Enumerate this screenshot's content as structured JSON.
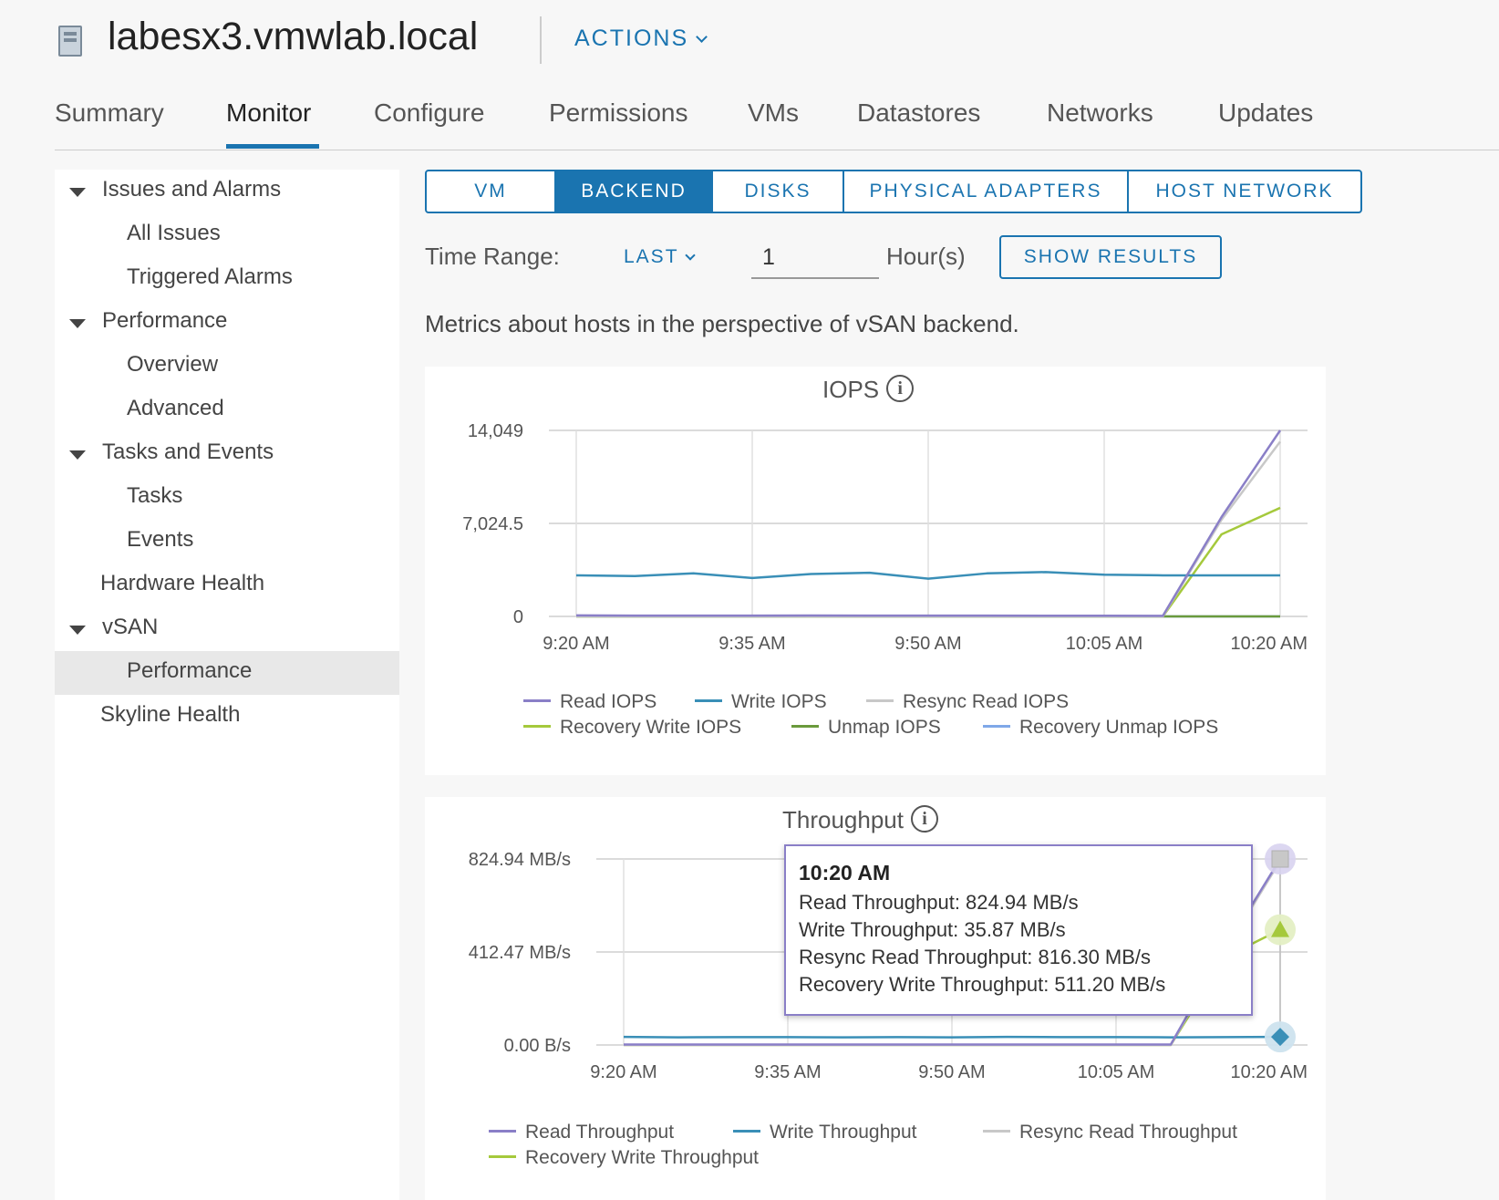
{
  "header": {
    "host_name": "labesx3.vmwlab.local",
    "actions_label": "ACTIONS"
  },
  "tabs": [
    "Summary",
    "Monitor",
    "Configure",
    "Permissions",
    "VMs",
    "Datastores",
    "Networks",
    "Updates"
  ],
  "active_tab": "Monitor",
  "sidebar": {
    "issues_and_alarms": "Issues and Alarms",
    "all_issues": "All Issues",
    "triggered_alarms": "Triggered Alarms",
    "performance": "Performance",
    "overview": "Overview",
    "advanced": "Advanced",
    "tasks_and_events": "Tasks and Events",
    "tasks": "Tasks",
    "events": "Events",
    "hardware_health": "Hardware Health",
    "vsan": "vSAN",
    "vsan_performance": "Performance",
    "skyline_health": "Skyline Health",
    "selected": "vsan_performance"
  },
  "subtabs": [
    "VM",
    "BACKEND",
    "DISKS",
    "PHYSICAL ADAPTERS",
    "HOST NETWORK"
  ],
  "active_subtab": "BACKEND",
  "time_range": {
    "label": "Time Range:",
    "mode": "LAST",
    "value": "1",
    "unit_label": "Hour(s)",
    "show_results_label": "SHOW RESULTS"
  },
  "description": "Metrics about hosts in the perspective of vSAN backend.",
  "colors": {
    "accent": "#1a74b0",
    "read": "#8a7fc7",
    "write": "#3a8fb7",
    "resync_read": "#c8c8c8",
    "recovery_write": "#a5c93c",
    "unmap": "#6a9a3c",
    "recovery_unmap": "#7fa8e8"
  },
  "chart_data": [
    {
      "type": "line",
      "title": "IOPS",
      "x": [
        "9:20 AM",
        "9:25 AM",
        "9:30 AM",
        "9:35 AM",
        "9:40 AM",
        "9:45 AM",
        "9:50 AM",
        "9:55 AM",
        "10:00 AM",
        "10:05 AM",
        "10:10 AM",
        "10:15 AM",
        "10:20 AM"
      ],
      "x_ticks": [
        "9:20 AM",
        "9:35 AM",
        "9:50 AM",
        "10:05 AM",
        "10:20 AM"
      ],
      "y_ticks": [
        "14,049",
        "7,024.5",
        "0"
      ],
      "ylim": [
        0,
        14049
      ],
      "series": [
        {
          "name": "Read IOPS",
          "color": "#8a7fc7",
          "values": [
            80,
            60,
            60,
            60,
            70,
            60,
            60,
            60,
            50,
            50,
            40,
            7500,
            14049
          ]
        },
        {
          "name": "Write IOPS",
          "color": "#3a8fb7",
          "values": [
            3100,
            3050,
            3250,
            2900,
            3200,
            3300,
            2850,
            3250,
            3350,
            3150,
            3100,
            3100,
            3100
          ]
        },
        {
          "name": "Resync Read IOPS",
          "color": "#c8c8c8",
          "values": [
            0,
            0,
            0,
            0,
            0,
            0,
            0,
            0,
            0,
            0,
            0,
            7300,
            13200
          ]
        },
        {
          "name": "Recovery Write IOPS",
          "color": "#a5c93c",
          "values": [
            0,
            0,
            0,
            0,
            0,
            0,
            0,
            0,
            0,
            0,
            0,
            6200,
            8200
          ]
        },
        {
          "name": "Unmap IOPS",
          "color": "#6a9a3c",
          "values": [
            0,
            0,
            0,
            0,
            0,
            0,
            0,
            0,
            0,
            0,
            0,
            0,
            0
          ]
        },
        {
          "name": "Recovery Unmap IOPS",
          "color": "#7fa8e8",
          "values": [
            0,
            0,
            0,
            0,
            0,
            0,
            0,
            0,
            0,
            0,
            0,
            0,
            0
          ]
        }
      ]
    },
    {
      "type": "line",
      "title": "Throughput",
      "x": [
        "9:20 AM",
        "9:25 AM",
        "9:30 AM",
        "9:35 AM",
        "9:40 AM",
        "9:45 AM",
        "9:50 AM",
        "9:55 AM",
        "10:00 AM",
        "10:05 AM",
        "10:10 AM",
        "10:15 AM",
        "10:20 AM"
      ],
      "x_ticks": [
        "9:20 AM",
        "9:35 AM",
        "9:50 AM",
        "10:05 AM",
        "10:20 AM"
      ],
      "y_ticks": [
        "824.94 MB/s",
        "412.47 MB/s",
        "0.00 B/s"
      ],
      "ylim": [
        0,
        824.94
      ],
      "series": [
        {
          "name": "Read Throughput",
          "color": "#8a7fc7",
          "values": [
            2,
            2,
            2,
            2,
            2,
            2,
            2,
            2,
            2,
            2,
            2,
            430,
            824.94
          ]
        },
        {
          "name": "Write Throughput",
          "color": "#3a8fb7",
          "values": [
            36,
            34,
            35,
            35,
            34,
            35,
            34,
            36,
            35,
            35,
            34,
            35,
            35.87
          ]
        },
        {
          "name": "Resync Read Throughput",
          "color": "#c8c8c8",
          "values": [
            0,
            0,
            0,
            0,
            0,
            0,
            0,
            0,
            0,
            0,
            0,
            420,
            816.3
          ]
        },
        {
          "name": "Recovery Write Throughput",
          "color": "#a5c93c",
          "values": [
            0,
            0,
            0,
            0,
            0,
            0,
            0,
            0,
            0,
            0,
            0,
            390,
            511.2
          ]
        }
      ],
      "tooltip": {
        "title": "10:20 AM",
        "lines": [
          "Read Throughput: 824.94 MB/s",
          "Write Throughput: 35.87 MB/s",
          "Resync Read Throughput: 816.30 MB/s",
          "Recovery Write Throughput: 511.20 MB/s"
        ]
      }
    }
  ]
}
